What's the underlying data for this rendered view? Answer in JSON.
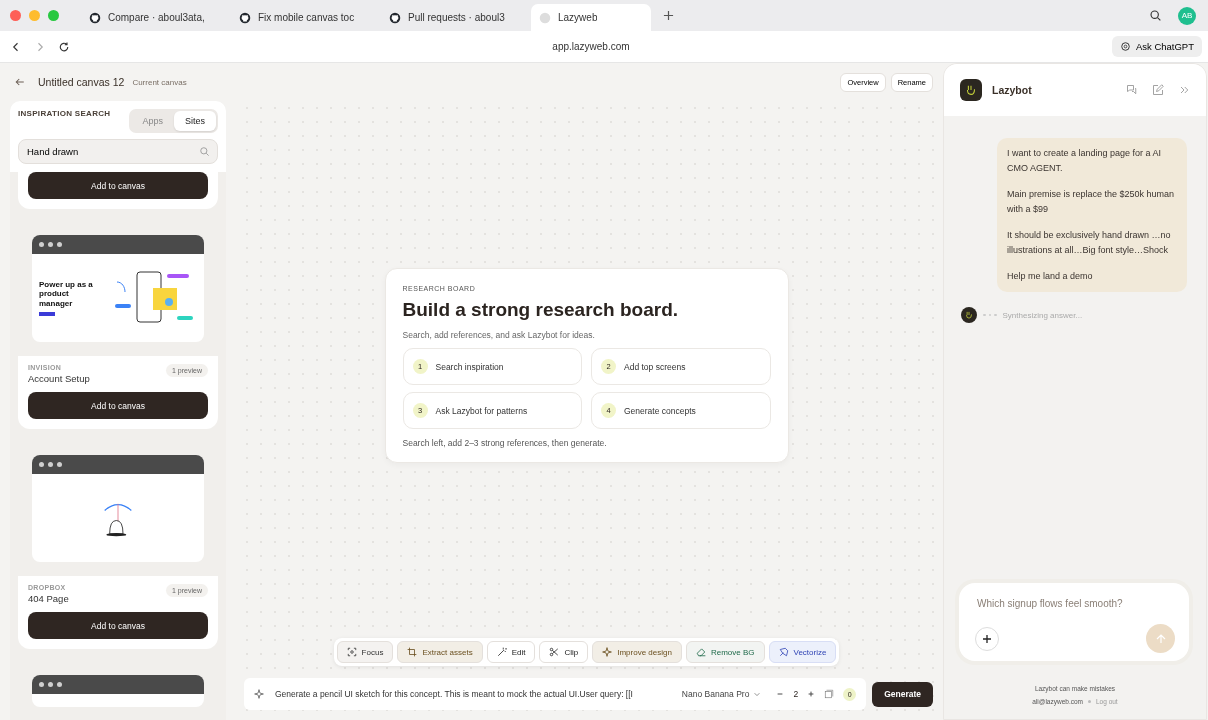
{
  "browser": {
    "tabs": [
      {
        "title": "Compare · aboul3ata,",
        "kind": "github",
        "selected": false
      },
      {
        "title": "Fix mobile canvas toc",
        "kind": "github",
        "selected": false
      },
      {
        "title": "Pull requests · aboul3",
        "kind": "github",
        "selected": false
      },
      {
        "title": "Lazyweb",
        "kind": "site",
        "selected": true
      }
    ],
    "address": "app.lazyweb.com",
    "avatar": "AB",
    "ask_button": "Ask ChatGPT"
  },
  "header": {
    "title": "Untitled canvas 12",
    "subtitle": "Current canvas",
    "buttons": [
      "Overview",
      "Rename"
    ]
  },
  "sidebar": {
    "title": "INSPIRATION SEARCH",
    "tabs": [
      {
        "label": "Apps",
        "selected": false
      },
      {
        "label": "Sites",
        "selected": true
      }
    ],
    "search": {
      "value": "Hand drawn"
    },
    "top_button": "Add to canvas",
    "results": [
      {
        "kind": "landing",
        "thumb_heading": "Power up as a product manager",
        "brand": "INVISION",
        "name": "Account Setup",
        "badge": "1 preview",
        "button": "Add to canvas"
      },
      {
        "kind": "illustration",
        "brand": "DROPBOX",
        "name": "404 Page",
        "badge": "1 preview",
        "button": "Add to canvas"
      }
    ]
  },
  "board": {
    "eyebrow": "RESEARCH BOARD",
    "title": "Build a strong research board.",
    "subtitle": "Search, add references, and ask Lazybot for ideas.",
    "steps": [
      {
        "number": "1",
        "label": "Search inspiration"
      },
      {
        "number": "2",
        "label": "Add top screens"
      },
      {
        "number": "3",
        "label": "Ask Lazybot for patterns"
      },
      {
        "number": "4",
        "label": "Generate concepts"
      }
    ],
    "hint": "Search left, add 2–3 strong references, then generate."
  },
  "toolbar": [
    {
      "label": "Focus",
      "kind": "neutral"
    },
    {
      "label": "Extract assets",
      "kind": "warm"
    },
    {
      "label": "Edit",
      "kind": "plain"
    },
    {
      "label": "Clip",
      "kind": "plain"
    },
    {
      "label": "Improve design",
      "kind": "warm"
    },
    {
      "label": "Remove BG",
      "kind": "green"
    },
    {
      "label": "Vectorize",
      "kind": "blue"
    }
  ],
  "prompt": {
    "value": "Generate a pencil UI sketch for this concept. This is meant to mock the actual UI.User query: [[I",
    "model": "Nano Banana Pro",
    "count": "2",
    "images": "0",
    "button": "Generate"
  },
  "chat": {
    "title": "Lazybot",
    "message": [
      "I want to create a landing page for a AI CMO AGENT.",
      "Main premise is replace the $250k human with a $99",
      "It should be exclusively hand drawn …no illustrations at all…Big font style…Shock",
      "Help me land a demo"
    ],
    "status": "Synthesizing answer...",
    "input": {
      "placeholder": "Which signup flows feel smooth?"
    },
    "footer": "Lazybot can make mistakes",
    "email": "ali@lazyweb.com",
    "logout": "Log out"
  }
}
